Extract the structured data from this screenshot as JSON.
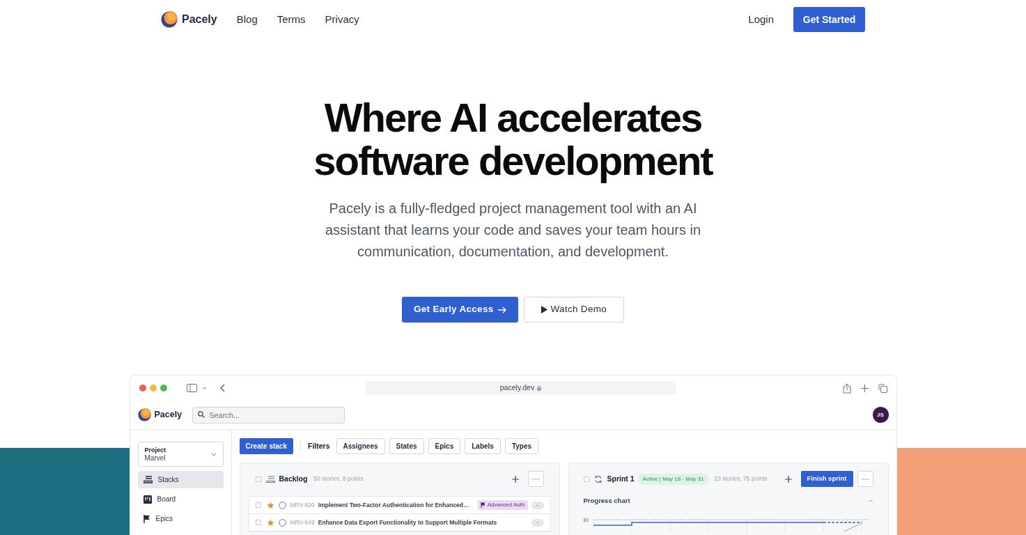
{
  "nav": {
    "brand": "Pacely",
    "links": [
      "Blog",
      "Terms",
      "Privacy"
    ],
    "login": "Login",
    "cta": "Get Started"
  },
  "hero": {
    "title": "Where AI accelerates software development",
    "subtitle": "Pacely is a fully-fledged project management tool with an AI assistant that learns your code and saves your team hours in communication, documentation, and development.",
    "primary_button": "Get Early Access",
    "secondary_button": "Watch Demo"
  },
  "mockup": {
    "url": "pacely.dev",
    "brand": "Pacely",
    "search": {
      "placeholder": "Search..."
    },
    "avatar": "JS",
    "project": {
      "label": "Project",
      "value": "Marvel"
    },
    "sidebar": {
      "items": [
        {
          "label": "Stacks",
          "selected": true,
          "kind": "stacks"
        },
        {
          "label": "Board",
          "selected": false,
          "kind": "board"
        },
        {
          "label": "Epics",
          "selected": false,
          "kind": "epics"
        }
      ]
    },
    "create_button": "Create stack",
    "filters_label": "Filters",
    "filters": [
      "Assignees",
      "States",
      "Epics",
      "Labels",
      "Types"
    ],
    "backlog": {
      "checked": false,
      "title": "Backlog",
      "meta": "50 stories, 8 points",
      "rows": [
        {
          "checked": false,
          "id": "MRV-820",
          "title": "Implement Two-Factor Authentication for Enhanced…",
          "tag": "Advanced Auth",
          "estimate": "-"
        },
        {
          "checked": false,
          "id": "MRV-849",
          "title": "Enhance Data Export Functionality to Support Multiple Formats",
          "estimate": "-"
        }
      ]
    },
    "sprint": {
      "checked": false,
      "title": "Sprint 1",
      "status": "Active | May 18 - May 31",
      "meta": "23 stories, 75 points",
      "button": "Finish sprint",
      "chart_title": "Progress chart",
      "chart_tick": "80"
    }
  }
}
